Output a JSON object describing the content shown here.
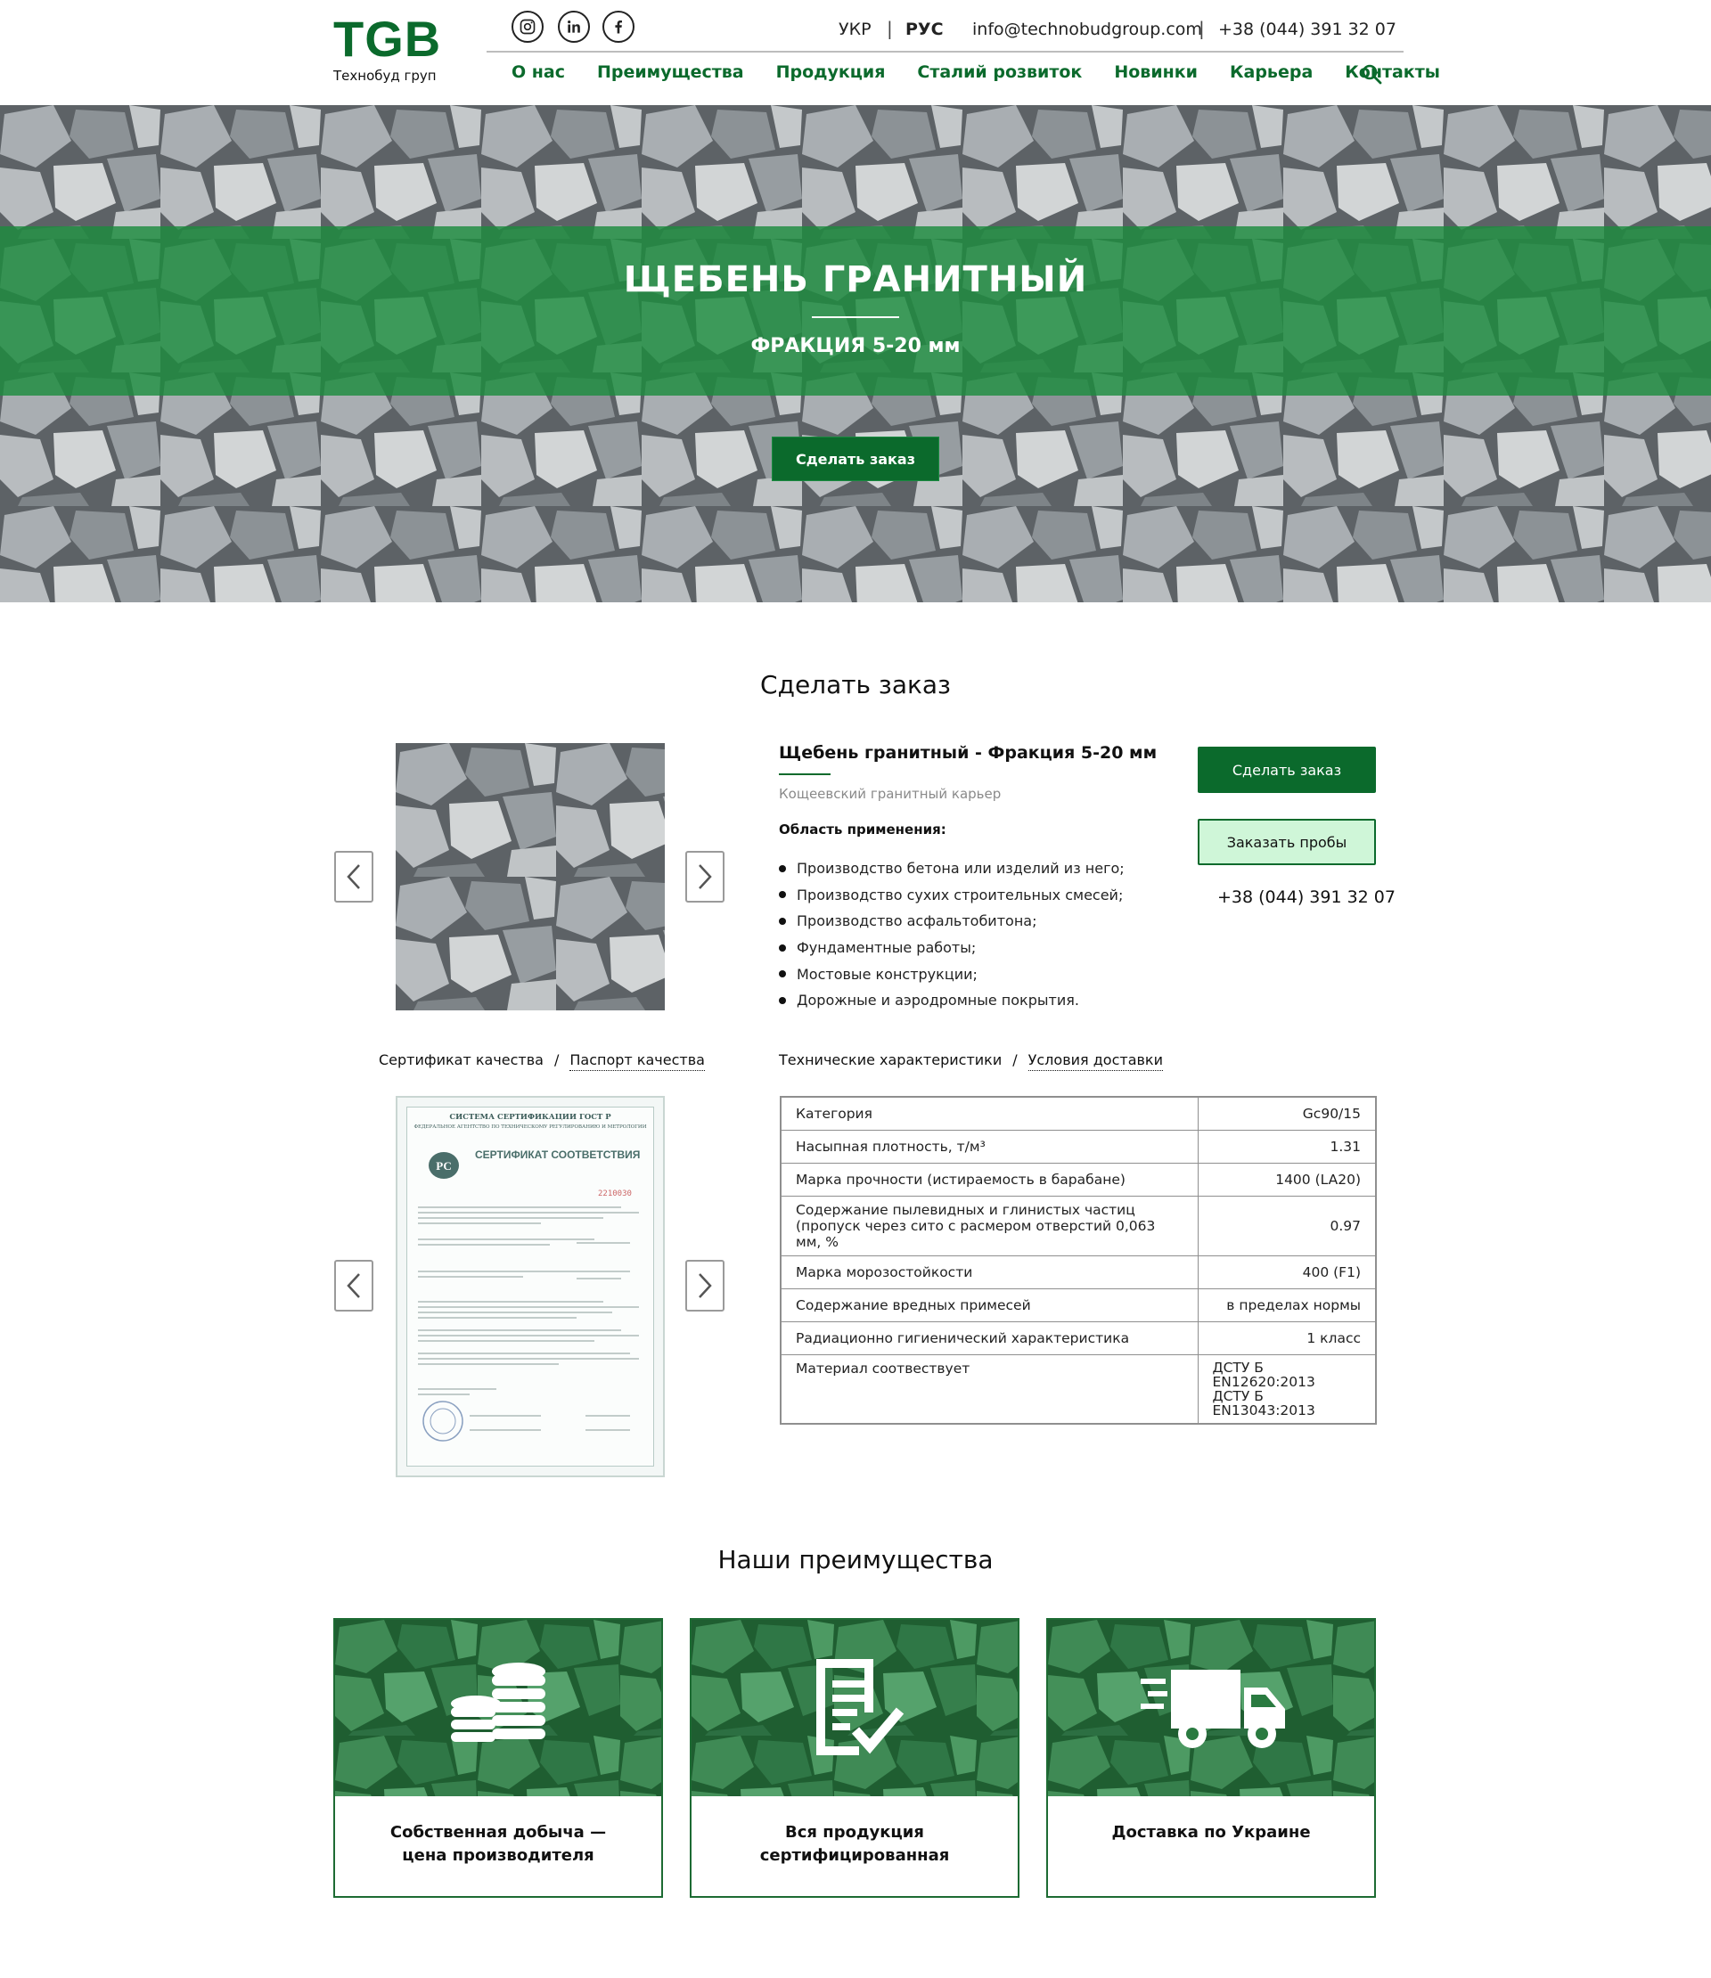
{
  "header": {
    "logo": "TGB",
    "logo_sub": "Технобуд груп",
    "lang_ukr": "УКР",
    "lang_sep": "|",
    "lang_rus": "РУС",
    "email": "info@technobudgroup.com",
    "phone": "+38 (044) 391 32 07",
    "nav": [
      "О нас",
      "Преимущества",
      "Продукция",
      "Сталий розвиток",
      "Новинки",
      "Карьера",
      "Контакты"
    ]
  },
  "hero": {
    "title": "ЩЕБЕНЬ ГРАНИТНЫЙ",
    "subtitle": "ФРАКЦИЯ 5-20 мм",
    "button": "Сделать заказ"
  },
  "order": {
    "title": "Сделать заказ",
    "product_title": "Щебень гранитный - Фракция 5-20 мм",
    "quarry": "Кощеевский гранитный карьер",
    "area_label": "Область применения:",
    "uses": [
      "Производство бетона или изделий из него;",
      "Производство сухих строительных смесей;",
      "Производство асфальтобитона;",
      "Фундаментные работы;",
      "Мостовые конструкции;",
      "Дорожные и аэродромные покрытия."
    ],
    "btn_order": "Сделать заказ",
    "btn_sample": "Заказать пробы",
    "phone": "+38 (044) 391 32 07"
  },
  "docs": {
    "tab1": "Сертификат качества",
    "sep": "/",
    "tab2": "Паспорт качества",
    "cert_header": "СИСТЕМА СЕРТИФИКАЦИИ ГОСТ Р",
    "cert_agency": "ФЕДЕРАЛЬНОЕ АГЕНТСТВО ПО ТЕХНИЧЕСКОМУ РЕГУЛИРОВАНИЮ И МЕТРОЛОГИИ",
    "cert_title": "СЕРТИФИКАТ СООТВЕТСТВИЯ",
    "cert_number": "2210030"
  },
  "specs": {
    "tab1": "Технические характеристики",
    "sep": "/",
    "tab2": "Условия доставки",
    "rows": [
      {
        "name": "Категория",
        "value": "Gc90/15"
      },
      {
        "name": "Насыпная плотность, т/м³",
        "value": "1.31"
      },
      {
        "name": "Марка прочности (истираемость в барабане)",
        "value": "1400 (LA20)"
      },
      {
        "name": "Содержание пылевидных и глинистых частиц (пропуск через сито с расмером отверстий 0,063 мм, %",
        "value": "0.97"
      },
      {
        "name": "Марка морозостойкости",
        "value": "400 (F1)"
      },
      {
        "name": "Содержание вредных примесей",
        "value": "в пределах нормы"
      },
      {
        "name": "Радиационно гигиенический характеристика",
        "value": "1 класс"
      },
      {
        "name": "Материал соотвествует",
        "value": "ДСТУ Б EN12620:2013\nДСТУ Б EN13043:2013"
      }
    ]
  },
  "advantages": {
    "title": "Наши преимущества",
    "cards": [
      {
        "text": "Собственная добыча —\nцена производителя",
        "icon": "coins-icon"
      },
      {
        "text": "Вся продукция\nсертифицированная",
        "icon": "document-check-icon"
      },
      {
        "text": "Доставка по Украине",
        "icon": "truck-icon"
      }
    ]
  },
  "colors": {
    "brand_green": "#0b6a2c",
    "hero_band": "#1c8c3e",
    "sample_bg": "#cff6d8"
  }
}
